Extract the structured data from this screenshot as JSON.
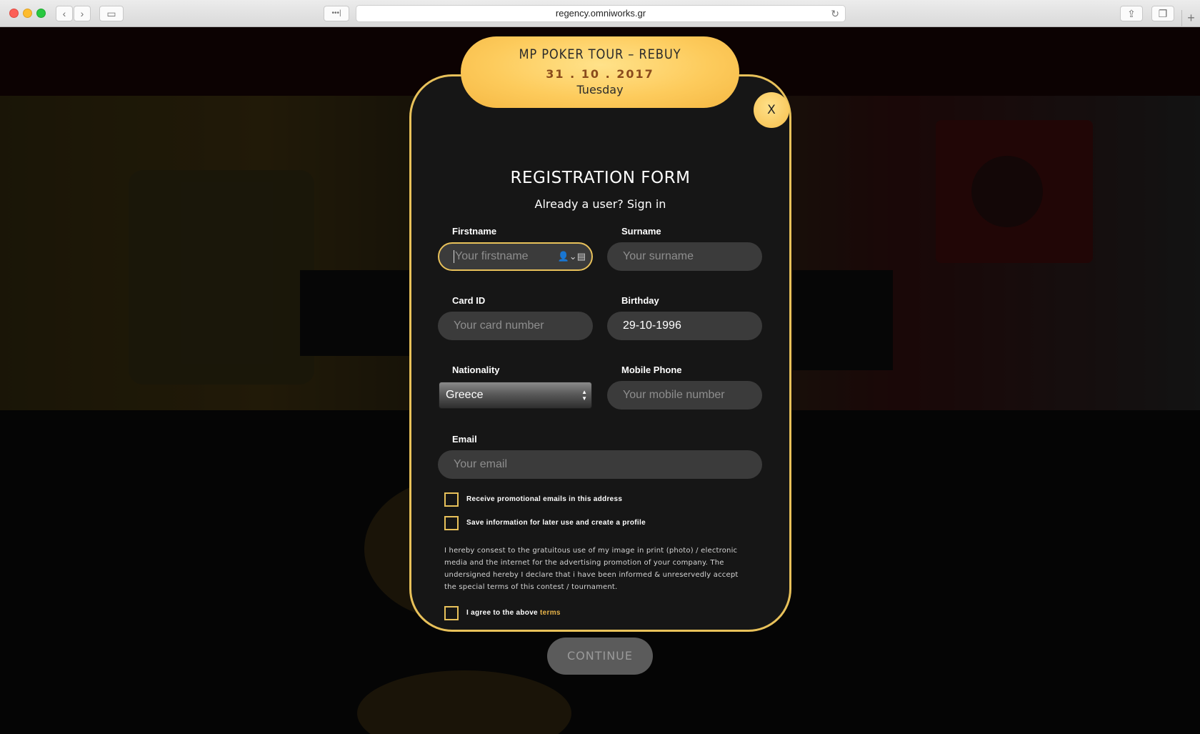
{
  "browser": {
    "url": "regency.omniworks.gr",
    "reader_icon": "•••|",
    "reload_icon": "↻",
    "new_tab_icon": "+"
  },
  "event": {
    "title": "MP POKER TOUR – REBUY",
    "date": "31 . 10 . 2017",
    "day": "Tuesday"
  },
  "modal": {
    "close_label": "X",
    "heading": "REGISTRATION FORM",
    "signin_text": "Already a user? Sign in"
  },
  "fields": {
    "firstname": {
      "label": "Firstname",
      "placeholder": "Your firstname",
      "value": ""
    },
    "surname": {
      "label": "Surname",
      "placeholder": "Your surname",
      "value": ""
    },
    "card_id": {
      "label": "Card ID",
      "placeholder": "Your card number",
      "value": ""
    },
    "birthday": {
      "label": "Birthday",
      "value": "29-10-1996"
    },
    "nationality": {
      "label": "Nationality",
      "selected": "Greece"
    },
    "mobile": {
      "label": "Mobile Phone",
      "placeholder": "Your mobile number",
      "value": ""
    },
    "email": {
      "label": "Email",
      "placeholder": "Your email",
      "value": ""
    }
  },
  "checkboxes": {
    "promo": {
      "label": "Receive promotional emails in this address",
      "checked": false
    },
    "save_profile": {
      "label": "Save information for later use and create a profile",
      "checked": false
    },
    "agree": {
      "label": "I agree to the above",
      "link": "terms",
      "checked": false
    }
  },
  "consent_text": "I hereby consest to the gratuitous use of my image in print (photo) / electronic media and the internet for the advertising promotion of your company. The undersigned hereby I declare that i have been informed & unreservedly accept the special terms of this contest / tournament.",
  "continue_label": "CONTINUE",
  "colors": {
    "accent": "#e8c15a",
    "link": "#e8b44a",
    "field_bg": "#3b3b3b",
    "modal_bg": "#161616"
  }
}
